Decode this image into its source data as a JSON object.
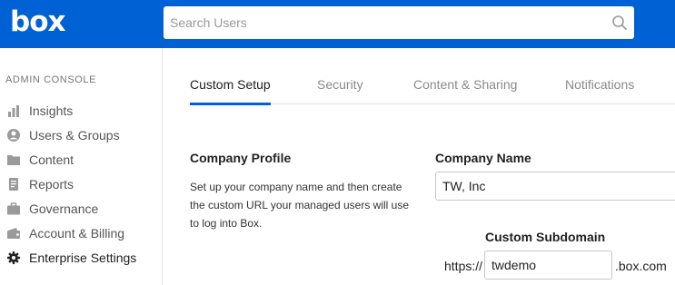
{
  "header": {
    "logo_text": "box",
    "search_placeholder": "Search Users",
    "brand_color": "#0061d5"
  },
  "sidebar": {
    "heading": "ADMIN CONSOLE",
    "items": [
      {
        "label": "Insights",
        "icon": "bar-chart-icon"
      },
      {
        "label": "Users & Groups",
        "icon": "user-circle-icon"
      },
      {
        "label": "Content",
        "icon": "folder-icon"
      },
      {
        "label": "Reports",
        "icon": "report-icon"
      },
      {
        "label": "Governance",
        "icon": "briefcase-icon"
      },
      {
        "label": "Account & Billing",
        "icon": "wallet-icon"
      },
      {
        "label": "Enterprise Settings",
        "icon": "gear-icon",
        "active": true
      }
    ]
  },
  "tabs": [
    {
      "label": "Custom Setup",
      "active": true
    },
    {
      "label": "Security"
    },
    {
      "label": "Content & Sharing"
    },
    {
      "label": "Notifications"
    }
  ],
  "company_profile": {
    "title": "Company Profile",
    "description": "Set up your company name and then create the custom URL your managed users will use to log into Box.",
    "company_name_label": "Company Name",
    "company_name_value": "TW, Inc",
    "subdomain_label": "Custom Subdomain",
    "subdomain_prefix": "https://",
    "subdomain_value": "twdemo",
    "subdomain_suffix": ".box.com"
  }
}
